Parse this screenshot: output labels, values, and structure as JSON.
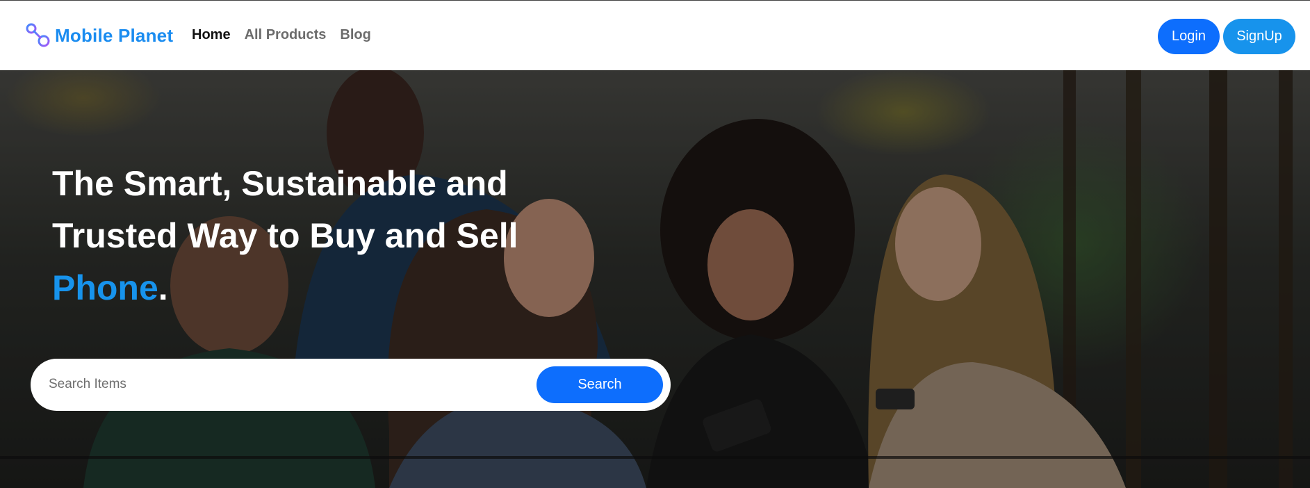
{
  "brand": {
    "name": "Mobile Planet",
    "logo_icon": "link-chain-icon",
    "color": "#1a8cf0"
  },
  "nav": {
    "items": [
      {
        "label": "Home",
        "active": true
      },
      {
        "label": "All Products",
        "active": false
      },
      {
        "label": "Blog",
        "active": false
      }
    ]
  },
  "auth": {
    "login_label": "Login",
    "signup_label": "SignUp",
    "login_color": "#0d6efd",
    "signup_color": "#1793ec"
  },
  "hero": {
    "title_line1": "The Smart, Sustainable and",
    "title_line2": "Trusted Way to Buy and Sell",
    "title_accent": "Phone",
    "title_period": ".",
    "accent_color": "#1793ec",
    "background": "photo of four young people smiling and looking at their phones outdoors"
  },
  "search": {
    "placeholder": "Search Items",
    "value": "",
    "button_label": "Search"
  }
}
